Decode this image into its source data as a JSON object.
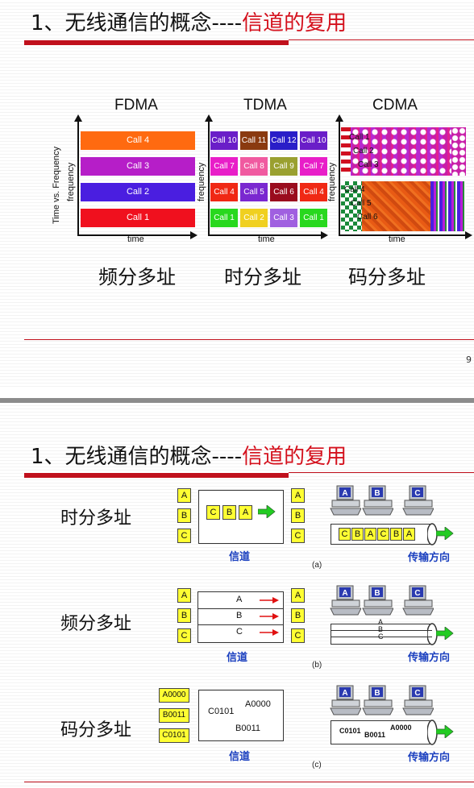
{
  "slide1": {
    "title_prefix": "1、无线通信的概念----",
    "title_highlight": "信道的复用",
    "page_number": "9",
    "methods": [
      {
        "header": "FDMA",
        "ylabel": "Time vs. Frequency",
        "ylabel2": "frequency",
        "xlabel": "time",
        "chinese": "频分多址",
        "calls": [
          "Call 4",
          "Call 3",
          "Call 2",
          "Call 1"
        ],
        "colors": [
          "#ff6a10",
          "#b61ec8",
          "#4a1ee0",
          "#f0101e"
        ]
      },
      {
        "header": "TDMA",
        "ylabel": "frequency",
        "xlabel": "time",
        "chinese": "时分多址",
        "grid": [
          [
            "Call 10",
            "Call 11",
            "Call 12",
            "Call 10"
          ],
          [
            "Call 7",
            "Call 8",
            "Call 9",
            "Call 7"
          ],
          [
            "Call 4",
            "Call 5",
            "Call 6",
            "Call 4"
          ],
          [
            "Call 1",
            "Call 2",
            "Call 3",
            "Call 1"
          ]
        ],
        "grid_colors": [
          [
            "#6a1ec8",
            "#8a3a10",
            "#2a1ec8",
            "#6a1ec8"
          ],
          [
            "#e81ec8",
            "#f05aa0",
            "#9aa030",
            "#e81ec8"
          ],
          [
            "#f02814",
            "#7a28d0",
            "#9a0c1e",
            "#f02814"
          ],
          [
            "#28d81e",
            "#f0d020",
            "#a060e0",
            "#28d81e"
          ]
        ]
      },
      {
        "header": "CDMA",
        "ylabel": "frequency",
        "xlabel": "time",
        "chinese": "码分多址",
        "top_calls": [
          "Call 1",
          "Call 2",
          "Call 3"
        ],
        "bottom_calls": [
          "Call 4",
          "Call 5",
          "Call 6"
        ]
      }
    ]
  },
  "slide2": {
    "title_prefix": "1、无线通信的概念----",
    "title_highlight": "信道的复用",
    "rows": [
      {
        "label": "时分多址",
        "left_boxes": [
          "A",
          "B",
          "C"
        ],
        "channel_boxes": [
          "C",
          "B",
          "A"
        ],
        "right_boxes": [
          "A",
          "B",
          "C"
        ],
        "channel_label": "信道",
        "caption": "(a)",
        "pc_labels": [
          "A",
          "B",
          "C"
        ],
        "bus_boxes": [
          "C",
          "B",
          "A",
          "C",
          "B",
          "A"
        ],
        "direction_label": "传输方向"
      },
      {
        "label": "频分多址",
        "left_boxes": [
          "A",
          "B",
          "C"
        ],
        "channel_rows": [
          "A",
          "B",
          "C"
        ],
        "right_boxes": [
          "A",
          "B",
          "C"
        ],
        "channel_label": "信道",
        "caption": "(b)",
        "pc_labels": [
          "A",
          "B",
          "C"
        ],
        "bus_letters": [
          "A",
          "B",
          "C"
        ],
        "direction_label": "传输方向"
      },
      {
        "label": "码分多址",
        "left_boxes": [
          "A0000",
          "B0011",
          "C0101"
        ],
        "channel_codes": [
          "C0101",
          "A0000",
          "B0011"
        ],
        "channel_label": "信道",
        "caption": "(c)",
        "pc_labels": [
          "A",
          "B",
          "C"
        ],
        "bus_codes": [
          "C0101",
          "B0011",
          "A0000"
        ],
        "direction_label": "传输方向"
      }
    ]
  },
  "colors": {
    "title_accent": "#d4101c",
    "channel_label": "#1a3fbf",
    "box_fill": "#ffff33",
    "arrow_green": "#22cc22",
    "arrow_red": "#e01010"
  }
}
